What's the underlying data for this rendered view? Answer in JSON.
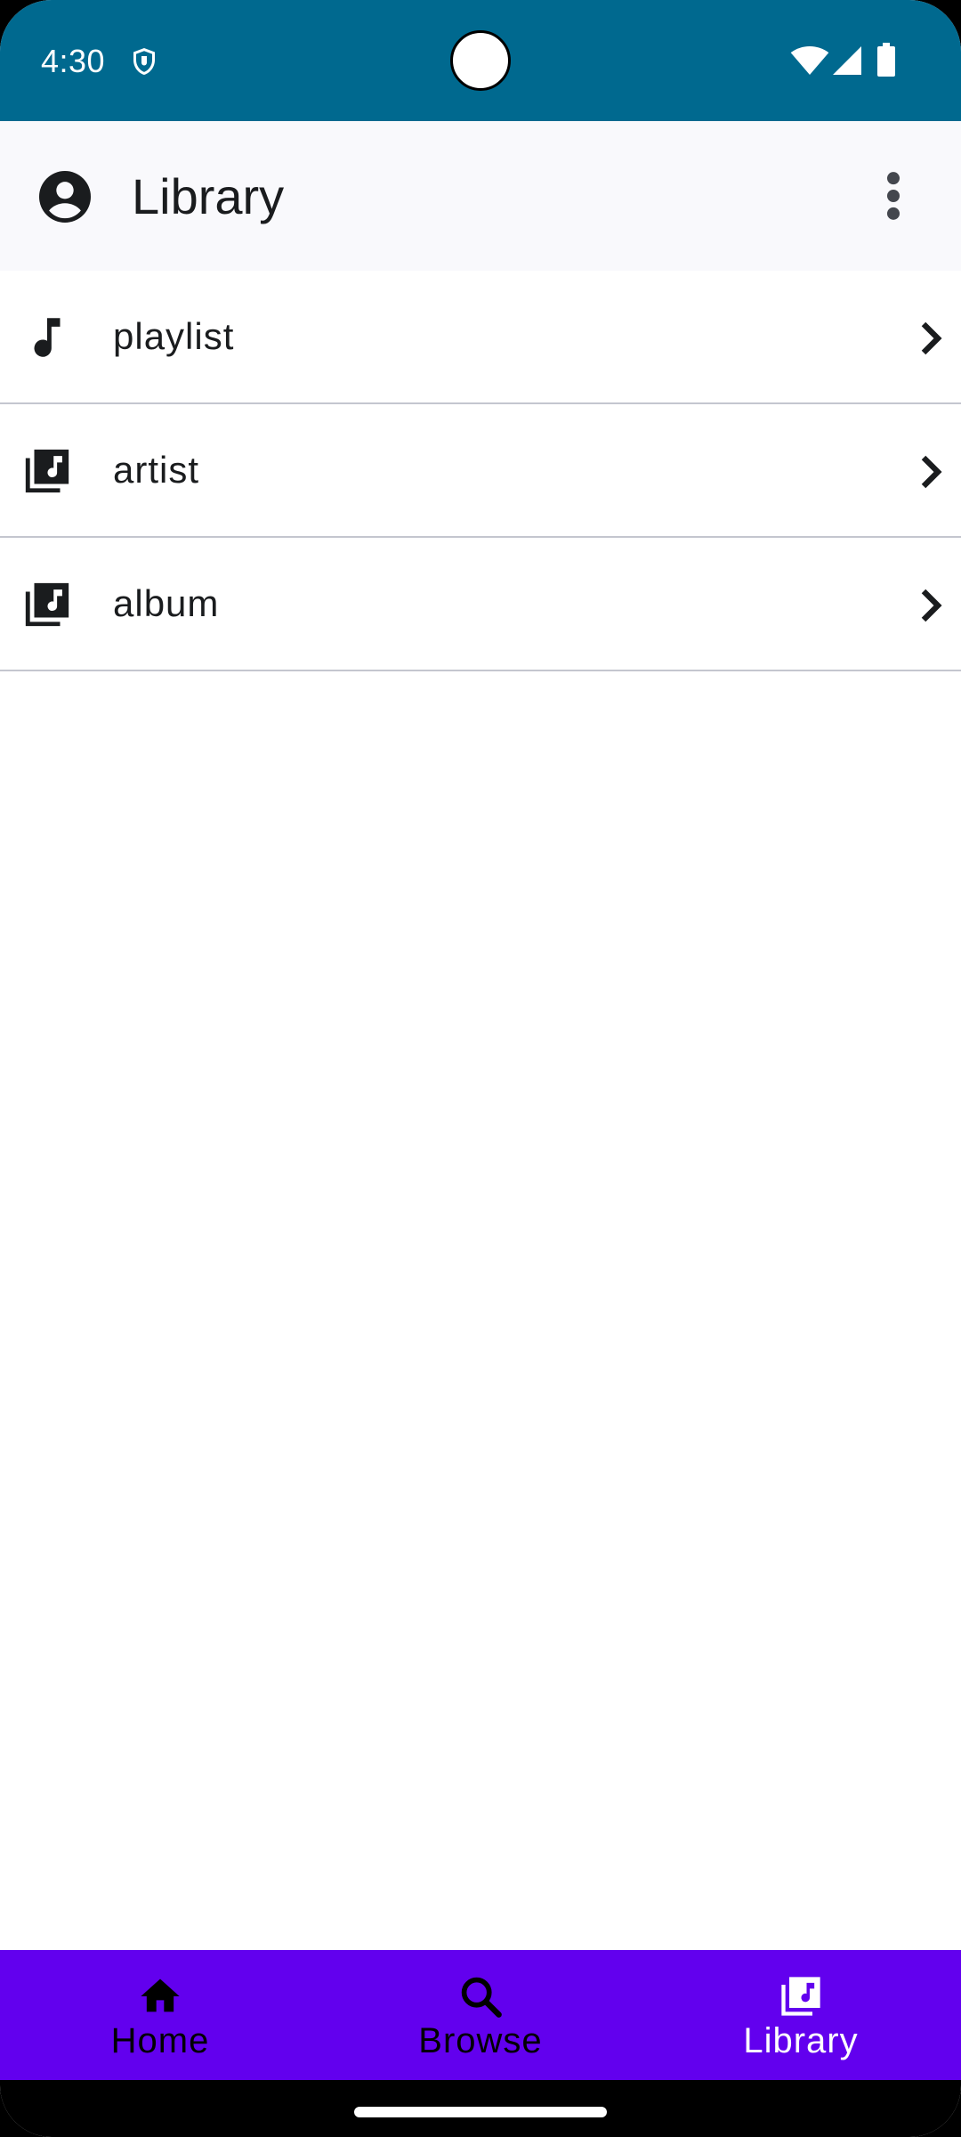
{
  "status_bar": {
    "time": "4:30",
    "icons": [
      "shield-icon",
      "wifi-icon",
      "signal-icon",
      "battery-icon"
    ]
  },
  "app_bar": {
    "title": "Library",
    "leading_icon": "account-circle-icon",
    "trailing_icon": "more-vert-icon"
  },
  "list": {
    "items": [
      {
        "label": "playlist",
        "icon": "music-note-icon"
      },
      {
        "label": "artist",
        "icon": "library-music-icon"
      },
      {
        "label": "album",
        "icon": "library-music-icon"
      }
    ]
  },
  "bottom_nav": {
    "items": [
      {
        "label": "Home",
        "icon": "home-icon",
        "active": false
      },
      {
        "label": "Browse",
        "icon": "search-icon",
        "active": false
      },
      {
        "label": "Library",
        "icon": "library-music-icon",
        "active": true
      }
    ]
  },
  "colors": {
    "status_bar": "#00698f",
    "app_bar": "#f9f9fc",
    "bottom_nav": "#6200ee",
    "divider": "#c4c6cf"
  }
}
